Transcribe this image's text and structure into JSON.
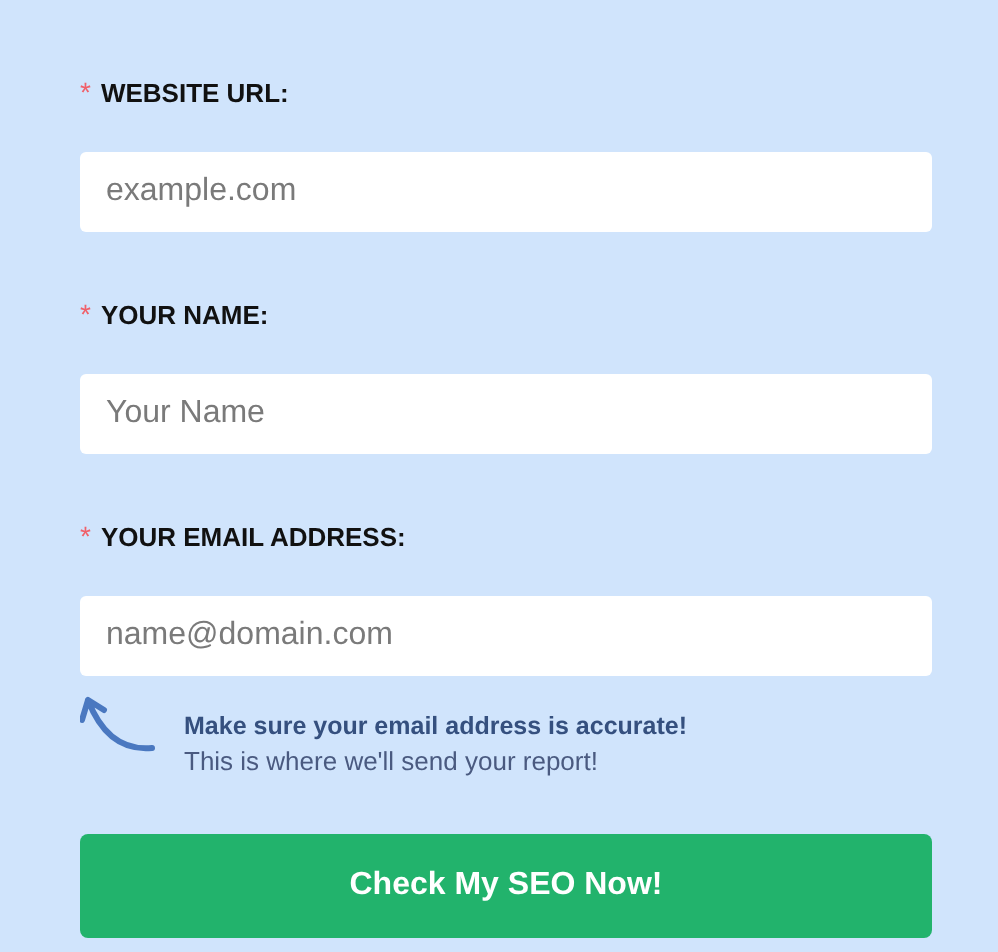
{
  "fields": [
    {
      "required_mark": "*",
      "label": "WEBSITE URL:",
      "placeholder": "example.com"
    },
    {
      "required_mark": "*",
      "label": "YOUR NAME:",
      "placeholder": "Your Name"
    },
    {
      "required_mark": "*",
      "label": "YOUR EMAIL ADDRESS:",
      "placeholder": "name@domain.com"
    }
  ],
  "hint": {
    "title": "Make sure your email address is accurate!",
    "text": "This is where we'll send your report!"
  },
  "submit_button": "Check My SEO Now!"
}
